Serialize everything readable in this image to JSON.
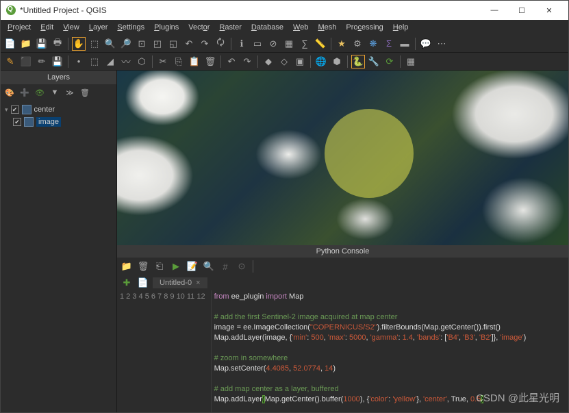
{
  "title": "*Untitled Project - QGIS",
  "menu": [
    "Project",
    "Edit",
    "View",
    "Layer",
    "Settings",
    "Plugins",
    "Vector",
    "Raster",
    "Database",
    "Web",
    "Mesh",
    "Processing",
    "Help"
  ],
  "layers_panel": {
    "title": "Layers",
    "items": [
      {
        "name": "center"
      },
      {
        "name": "image"
      }
    ]
  },
  "python_console": {
    "title": "Python Console",
    "tab": "Untitled-0"
  },
  "code": {
    "l1": {
      "a": "from",
      "b": " ee_plugin ",
      "c": "import",
      "d": " Map"
    },
    "l3": "# add the first Sentinel-2 image acquired at map center",
    "l4": {
      "a": "image = ee.ImageCollection(",
      "b": "\"COPERNICUS/S2\"",
      "c": ").filterBounds(Map.getCenter()).first()"
    },
    "l5": {
      "a": "Map.addLayer(image, {",
      "b": "'min'",
      "c": ": ",
      "d": "500",
      "e": ", ",
      "f": "'max'",
      "g": ": ",
      "h": "5000",
      "i": ", ",
      "j": "'gamma'",
      "k": ": ",
      "l": "1.4",
      "m": ", ",
      "n": "'bands'",
      "o": ": [",
      "p": "'B4'",
      "q": ", ",
      "r": "'B3'",
      "s": ", ",
      "t": "'B2'",
      "u": "]}, ",
      "v": "'image'",
      "w": ")"
    },
    "l7": "# zoom in somewhere",
    "l8": {
      "a": "Map.setCenter(",
      "b": "4.4085",
      "c": ", ",
      "d": "52.0774",
      "e": ", ",
      "f": "14",
      "g": ")"
    },
    "l10": "# add map center as a layer, buffered",
    "l11": {
      "a": "Map.addLayer",
      "b": "(",
      "c": "Map.getCenter().buffer(",
      "d": "1000",
      "e": "), {",
      "f": "'color'",
      "g": ": ",
      "h": "'yellow'",
      "i": "}, ",
      "j": "'center'",
      "k": ", True, ",
      "l": "0.5",
      "m": ")"
    }
  },
  "watermark": "CSDN @此星光明"
}
